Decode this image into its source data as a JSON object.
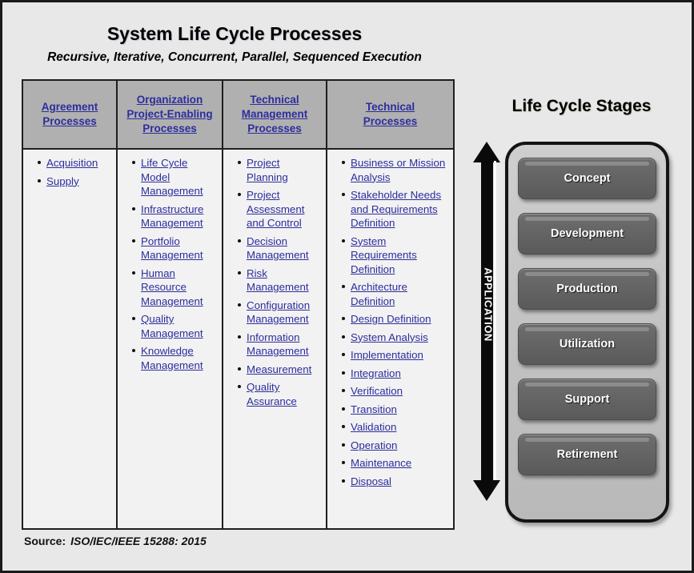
{
  "title": "System Life Cycle Processes",
  "subtitle": "Recursive, Iterative, Concurrent, Parallel, Sequenced Execution",
  "source": {
    "label": "Source:",
    "value": "ISO/IEC/IEEE 15288: 2015"
  },
  "colors": {
    "link_text": "#2d2d9e",
    "header_fill": "#b0b0b0",
    "body_fill": "#f2f2f2",
    "page_bg": "#e8e8e8",
    "stage_box": "#656565",
    "arrow": "#0a0a0a"
  },
  "table": {
    "columns": [
      {
        "header_lines": [
          "Agreement",
          "Processes"
        ],
        "items": [
          "Acquisition",
          "Supply"
        ]
      },
      {
        "header_lines": [
          "Organization",
          "Project-Enabling",
          "Processes"
        ],
        "items": [
          "Life Cycle Model Management",
          "Infrastructure Management",
          "Portfolio Management",
          "Human Resource Management",
          "Quality Management",
          "Knowledge Management"
        ]
      },
      {
        "header_lines": [
          "Technical",
          "Management",
          "Processes"
        ],
        "items": [
          "Project Planning",
          "Project Assessment and Control",
          "Decision Management",
          "Risk Management",
          "Configuration Management",
          "Information Management",
          "Measurement",
          "Quality Assurance"
        ]
      },
      {
        "header_lines": [
          "Technical",
          "Processes"
        ],
        "items": [
          "Business or Mission Analysis",
          "Stakeholder Needs and Requirements Definition",
          "System Requirements Definition",
          "Architecture Definition",
          "Design Definition",
          "System Analysis",
          "Implementation",
          "Integration",
          "Verification",
          "Transition",
          "Validation",
          "Operation",
          "Maintenance",
          "Disposal"
        ]
      }
    ]
  },
  "stages_panel": {
    "title": "Life Cycle Stages",
    "arrow_label": "APPLICATION",
    "stages": [
      "Concept",
      "Development",
      "Production",
      "Utilization",
      "Support",
      "Retirement"
    ]
  }
}
